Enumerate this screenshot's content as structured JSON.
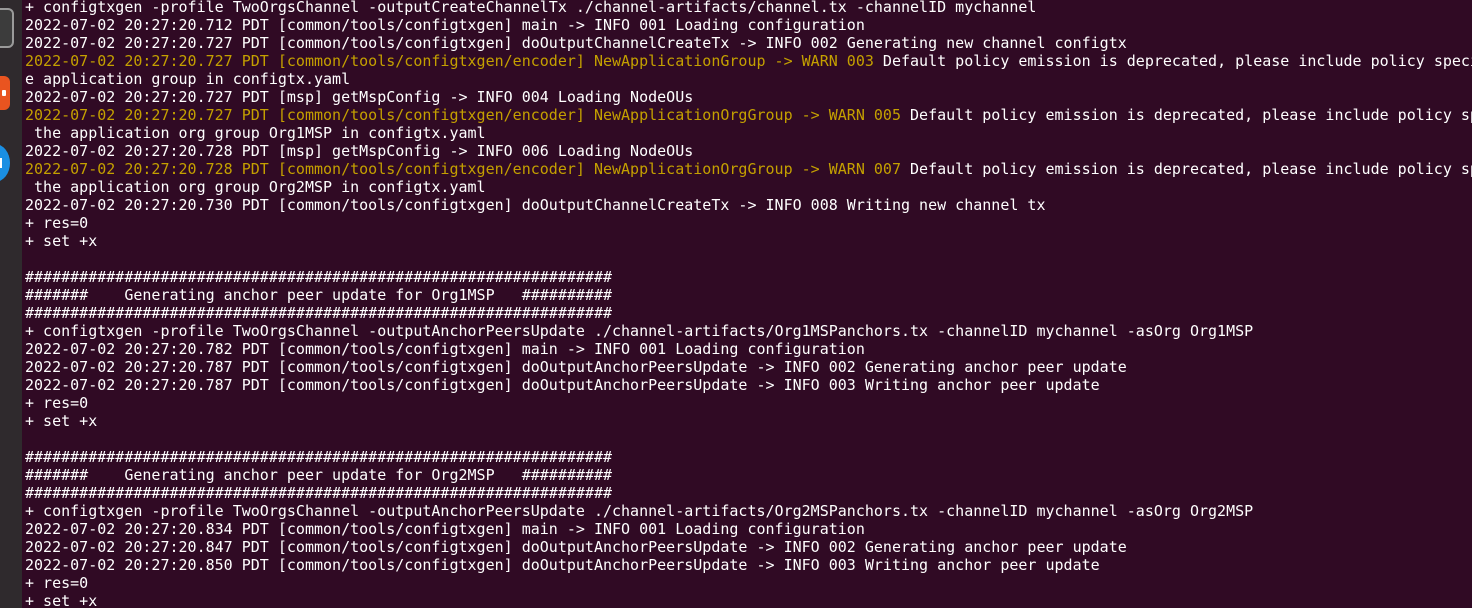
{
  "dock": {
    "items": [
      {
        "name": "terminal-app-icon"
      },
      {
        "name": "software-center-icon"
      },
      {
        "name": "help-icon"
      }
    ]
  },
  "colors": {
    "background": "#300a24",
    "text": "#ffffff",
    "warn": "#c4a000"
  },
  "terminal": {
    "lines": [
      {
        "text": "+ configtxgen -profile TwoOrgsChannel -outputCreateChannelTx ./channel-artifacts/channel.tx -channelID mychannel"
      },
      {
        "text": "2022-07-02 20:27:20.712 PDT [common/tools/configtxgen] main -> INFO 001 Loading configuration"
      },
      {
        "text": "2022-07-02 20:27:20.727 PDT [common/tools/configtxgen] doOutputChannelCreateTx -> INFO 002 Generating new channel configtx"
      },
      {
        "warn": "2022-07-02 20:27:20.727 PDT [common/tools/configtxgen/encoder] NewApplicationGroup -> WARN 003",
        "text": " Default policy emission is deprecated, please include policy speci"
      },
      {
        "text": "e application group in configtx.yaml"
      },
      {
        "text": "2022-07-02 20:27:20.727 PDT [msp] getMspConfig -> INFO 004 Loading NodeOUs"
      },
      {
        "warn": "2022-07-02 20:27:20.727 PDT [common/tools/configtxgen/encoder] NewApplicationOrgGroup -> WARN 005",
        "text": " Default policy emission is deprecated, please include policy sp"
      },
      {
        "text": " the application org group Org1MSP in configtx.yaml"
      },
      {
        "text": "2022-07-02 20:27:20.728 PDT [msp] getMspConfig -> INFO 006 Loading NodeOUs"
      },
      {
        "warn": "2022-07-02 20:27:20.728 PDT [common/tools/configtxgen/encoder] NewApplicationOrgGroup -> WARN 007",
        "text": " Default policy emission is deprecated, please include policy sp"
      },
      {
        "text": " the application org group Org2MSP in configtx.yaml"
      },
      {
        "text": "2022-07-02 20:27:20.730 PDT [common/tools/configtxgen] doOutputChannelCreateTx -> INFO 008 Writing new channel tx"
      },
      {
        "text": "+ res=0"
      },
      {
        "text": "+ set +x"
      },
      {
        "text": ""
      },
      {
        "text": "#################################################################"
      },
      {
        "text": "#######    Generating anchor peer update for Org1MSP   ##########"
      },
      {
        "text": "#################################################################"
      },
      {
        "text": "+ configtxgen -profile TwoOrgsChannel -outputAnchorPeersUpdate ./channel-artifacts/Org1MSPanchors.tx -channelID mychannel -asOrg Org1MSP"
      },
      {
        "text": "2022-07-02 20:27:20.782 PDT [common/tools/configtxgen] main -> INFO 001 Loading configuration"
      },
      {
        "text": "2022-07-02 20:27:20.787 PDT [common/tools/configtxgen] doOutputAnchorPeersUpdate -> INFO 002 Generating anchor peer update"
      },
      {
        "text": "2022-07-02 20:27:20.787 PDT [common/tools/configtxgen] doOutputAnchorPeersUpdate -> INFO 003 Writing anchor peer update"
      },
      {
        "text": "+ res=0"
      },
      {
        "text": "+ set +x"
      },
      {
        "text": ""
      },
      {
        "text": "#################################################################"
      },
      {
        "text": "#######    Generating anchor peer update for Org2MSP   ##########"
      },
      {
        "text": "#################################################################"
      },
      {
        "text": "+ configtxgen -profile TwoOrgsChannel -outputAnchorPeersUpdate ./channel-artifacts/Org2MSPanchors.tx -channelID mychannel -asOrg Org2MSP"
      },
      {
        "text": "2022-07-02 20:27:20.834 PDT [common/tools/configtxgen] main -> INFO 001 Loading configuration"
      },
      {
        "text": "2022-07-02 20:27:20.847 PDT [common/tools/configtxgen] doOutputAnchorPeersUpdate -> INFO 002 Generating anchor peer update"
      },
      {
        "text": "2022-07-02 20:27:20.850 PDT [common/tools/configtxgen] doOutputAnchorPeersUpdate -> INFO 003 Writing anchor peer update"
      },
      {
        "text": "+ res=0"
      },
      {
        "text": "+ set +x"
      }
    ]
  }
}
